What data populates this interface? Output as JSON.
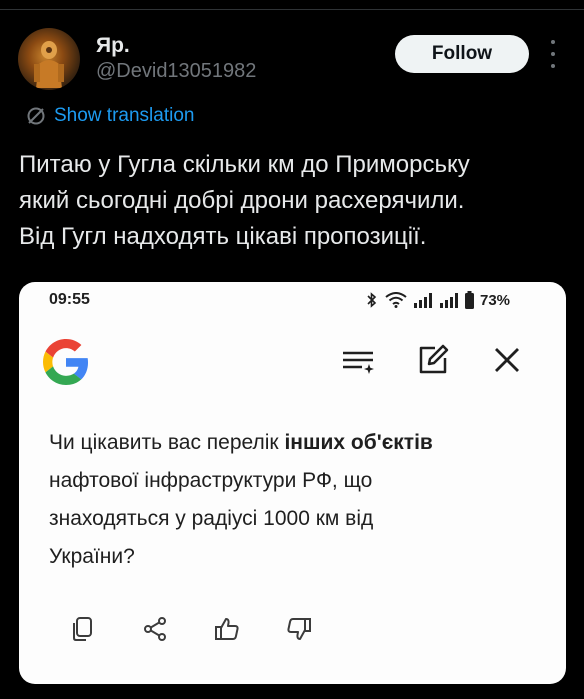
{
  "post": {
    "display_name": "Яр.",
    "handle": "@Devid13051982",
    "follow_label": "Follow",
    "show_translation": "Show translation",
    "text_lines": [
      "Питаю у Гугла скільки км до Приморську",
      "який сьогодні добрі дрони расхерячили.",
      "Від Гугл надходять цікаві пропозиції."
    ]
  },
  "phone_status": {
    "time": "09:55",
    "battery": "73%"
  },
  "assistant": {
    "answer_part1_line1": "Чи цікавить вас перелік ",
    "answer_bold_line1": "інших об'єктів",
    "answer_line2": "нафтової інфраструктури РФ, що",
    "answer_line3": "знаходяться у радіусі 1000 км від",
    "answer_line4": "України?"
  },
  "icons": {
    "google": "google-g-icon",
    "list": "list-sparkle-icon",
    "edit": "edit-icon",
    "close": "close-icon",
    "copy": "copy-icon",
    "share": "share-icon",
    "thumbs_up": "thumbs-up-icon",
    "thumbs_down": "thumbs-down-icon"
  },
  "colors": {
    "background": "#000000",
    "link": "#1d9bf0",
    "muted": "#71767b",
    "google_blue": "#4285F4",
    "google_red": "#EA4335",
    "google_yellow": "#FBBC05",
    "google_green": "#34A853"
  }
}
